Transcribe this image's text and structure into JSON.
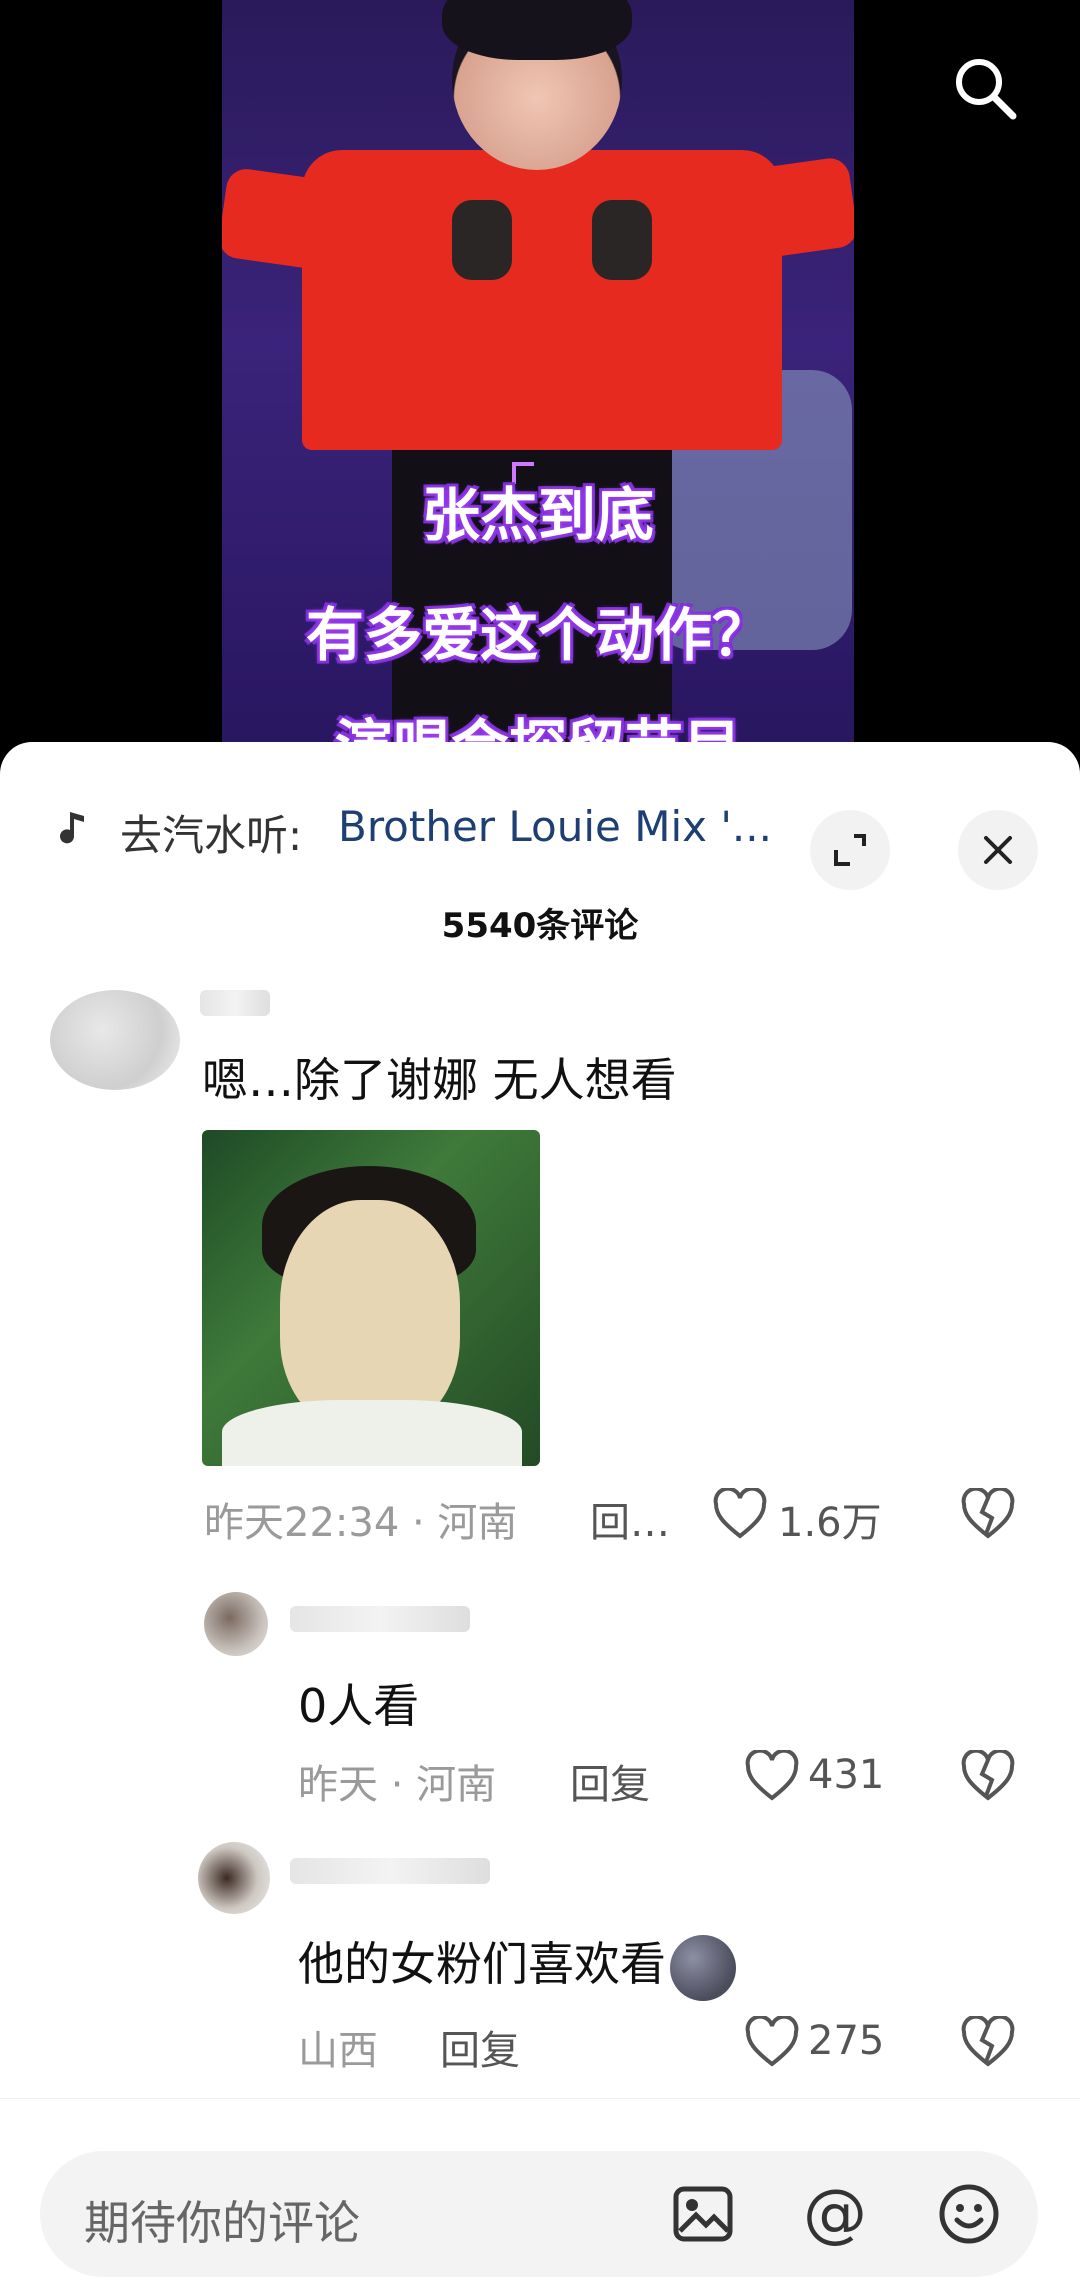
{
  "video": {
    "caption_lines": [
      "张杰到底",
      "有多爱这个动作？",
      "演唱会探留节目"
    ]
  },
  "music": {
    "prefix": "去汽水听:",
    "title": "Brother Louie Mix '..."
  },
  "comments_header": {
    "count_label": "5540条评论"
  },
  "comments": [
    {
      "text": "嗯…除了谢娜 无人想看",
      "time": "昨天22:34 · 河南",
      "reply": "回…",
      "likes": "1.6万"
    },
    {
      "text": "0人看",
      "time": "昨天 · 河南",
      "reply": "回复",
      "likes": "431"
    },
    {
      "text": "他的女粉们喜欢看",
      "time": "山西",
      "reply": "回复",
      "likes": "275"
    }
  ],
  "input": {
    "placeholder": "期待你的评论"
  },
  "icons": {
    "search": "search-icon",
    "music": "music-note-icon",
    "expand": "expand-icon",
    "close": "close-icon",
    "like": "heart-icon",
    "dislike": "broken-heart-icon",
    "image": "image-icon",
    "mention": "at-icon",
    "emoji": "smiley-icon"
  }
}
